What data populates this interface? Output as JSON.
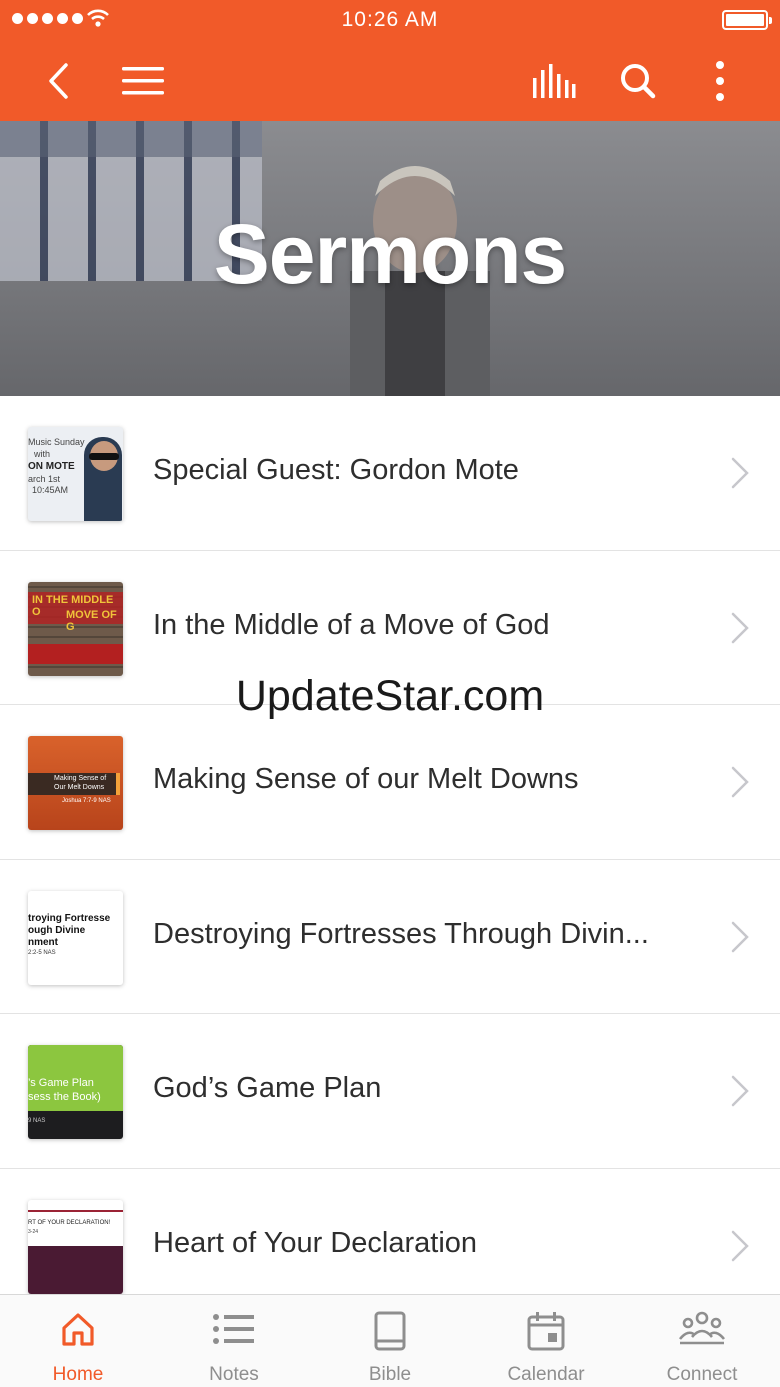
{
  "status_bar": {
    "time": "10:26 AM"
  },
  "hero": {
    "title": "Sermons"
  },
  "sermons": [
    {
      "title": "Special Guest: Gordon Mote",
      "thumb_lines": [
        "Music Sunday",
        "with",
        "ON MOTE",
        "arch 1st",
        "10:45AM"
      ]
    },
    {
      "title": "In the Middle of a Move of God",
      "thumb_lines": [
        "IN THE MIDDLE O",
        "MOVE OF G"
      ]
    },
    {
      "title": "Making Sense of our Melt Downs",
      "thumb_lines": [
        "Making Sense of",
        "Our Melt Downs",
        "Joshua 7:7-9 NAS"
      ]
    },
    {
      "title": "Destroying Fortresses Through Divin...",
      "thumb_lines": [
        "troying Fortresse",
        "ough Divine",
        "nment",
        "2:2-5 NAS"
      ]
    },
    {
      "title": "God’s Game Plan",
      "thumb_lines": [
        "’s Game Plan",
        "sess the Book)",
        "9 NAS"
      ]
    },
    {
      "title": "Heart of Your Declaration",
      "thumb_lines": [
        "RT OF YOUR DECLARATION!",
        "3-24"
      ]
    }
  ],
  "watermark": "UpdateStar.com",
  "tabs": [
    {
      "label": "Home",
      "icon": "home-icon",
      "active": true
    },
    {
      "label": "Notes",
      "icon": "list-icon",
      "active": false
    },
    {
      "label": "Bible",
      "icon": "book-icon",
      "active": false
    },
    {
      "label": "Calendar",
      "icon": "calendar-icon",
      "active": false
    },
    {
      "label": "Connect",
      "icon": "people-icon",
      "active": false
    }
  ],
  "colors": {
    "accent": "#f15a29",
    "tab_inactive": "#8e8e8e"
  }
}
